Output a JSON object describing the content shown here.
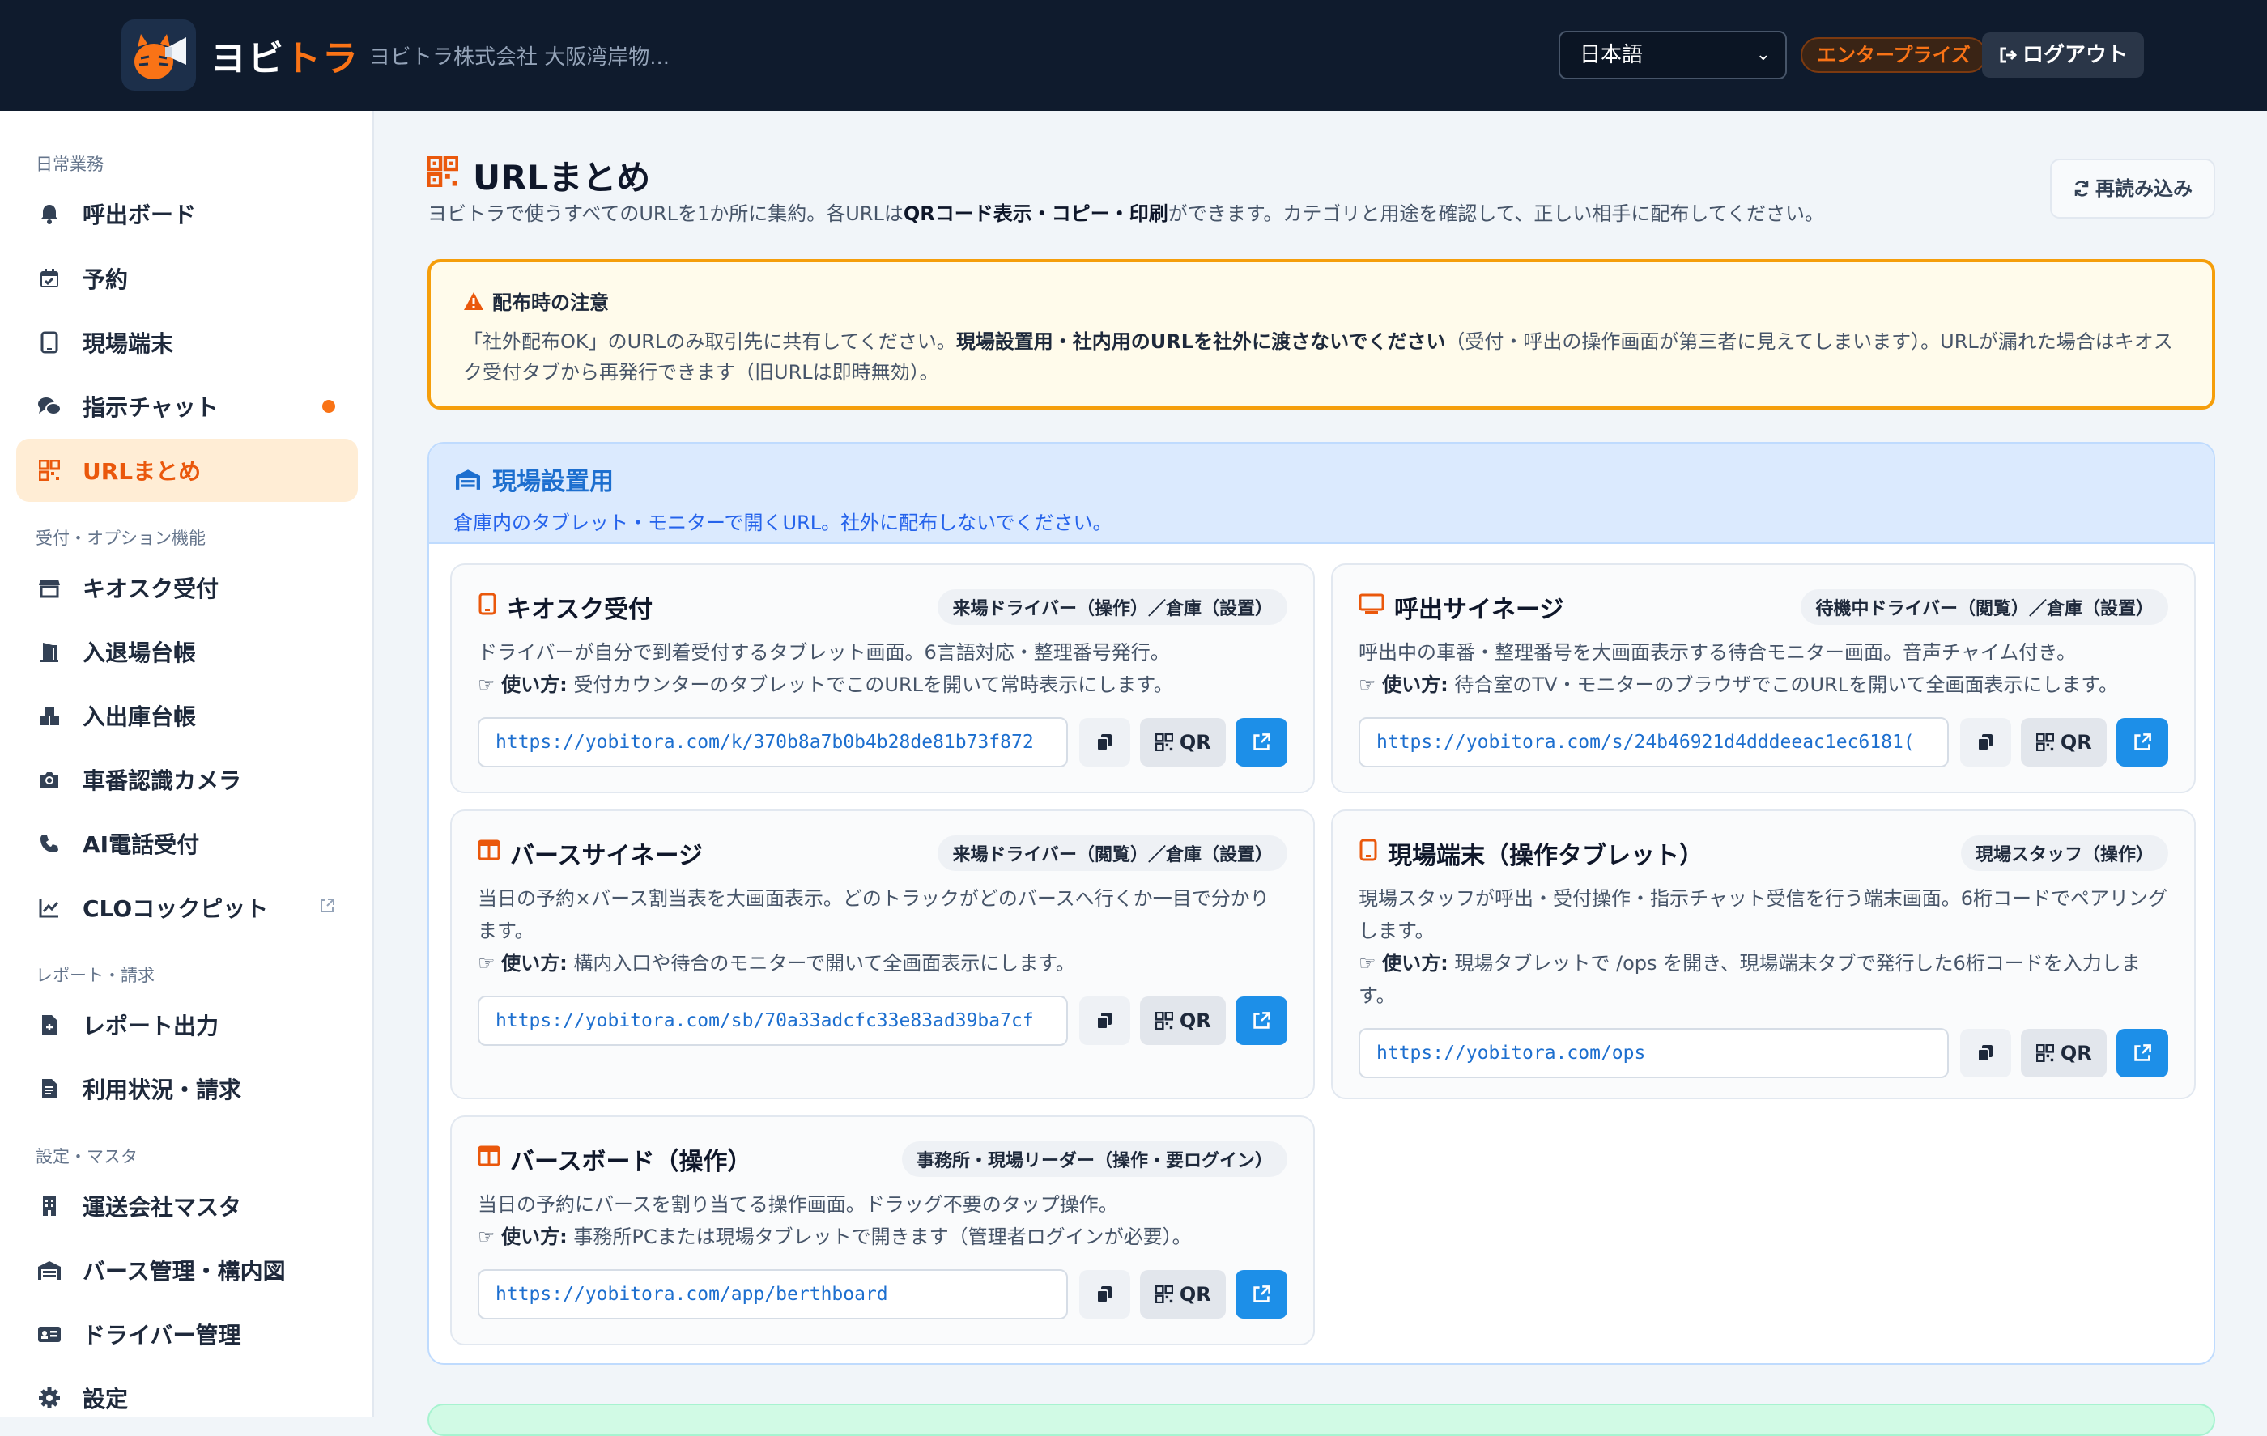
{
  "header": {
    "brand_part1": "ヨビ",
    "brand_part2": "トラ",
    "company": "ヨビトラ株式会社 大阪湾岸物...",
    "language": "日本語",
    "plan": "エンタープライズ",
    "logout": "ログアウト"
  },
  "sidebar": {
    "sections": [
      "日常業務",
      "受付・オプション機能",
      "レポート・請求",
      "設定・マスタ"
    ],
    "items": [
      {
        "label": "呼出ボード"
      },
      {
        "label": "予約"
      },
      {
        "label": "現場端末"
      },
      {
        "label": "指示チャット"
      },
      {
        "label": "URLまとめ"
      },
      {
        "label": "キオスク受付"
      },
      {
        "label": "入退場台帳"
      },
      {
        "label": "入出庫台帳"
      },
      {
        "label": "車番認識カメラ"
      },
      {
        "label": "AI電話受付"
      },
      {
        "label": "CLOコックピット"
      },
      {
        "label": "レポート出力"
      },
      {
        "label": "利用状況・請求"
      },
      {
        "label": "運送会社マスタ"
      },
      {
        "label": "バース管理・構内図"
      },
      {
        "label": "ドライバー管理"
      },
      {
        "label": "設定"
      }
    ]
  },
  "page": {
    "title": "URLまとめ",
    "sub_pre": "ヨビトラで使うすべてのURLを1か所に集約。各URLは",
    "sub_bold": "QRコード表示・コピー・印刷",
    "sub_post": "ができます。カテゴリと用途を確認して、正しい相手に配布してください。",
    "reload": "再読み込み"
  },
  "notice": {
    "title": "配布時の注意",
    "pre": "「社外配布OK」のURLのみ取引先に共有してください。",
    "bold": "現場設置用・社内用のURLを社外に渡さないでください",
    "post": "（受付・呼出の操作画面が第三者に見えてしまいます）。URLが漏れた場合はキオスク受付タブから再発行できます（旧URLは即時無効）。"
  },
  "section": {
    "title": "現場設置用",
    "sub": "倉庫内のタブレット・モニターで開くURL。社外に配布しないでください。",
    "usage_label": "使い方:",
    "qr_label": "QR",
    "cards": [
      {
        "title": "キオスク受付",
        "role": "来場ドライバー（操作）／倉庫（設置）",
        "desc": "ドライバーが自分で到着受付するタブレット画面。6言語対応・整理番号発行。",
        "usage": "受付カウンターのタブレットでこのURLを開いて常時表示にします。",
        "url": "https://yobitora.com/k/370b8a7b0b4b28de81b73f872"
      },
      {
        "title": "呼出サイネージ",
        "role": "待機中ドライバー（閲覧）／倉庫（設置）",
        "desc": "呼出中の車番・整理番号を大画面表示する待合モニター画面。音声チャイム付き。",
        "usage": "待合室のTV・モニターのブラウザでこのURLを開いて全画面表示にします。",
        "url": "https://yobitora.com/s/24b46921d4dddeeac1ec6181("
      },
      {
        "title": "バースサイネージ",
        "role": "来場ドライバー（閲覧）／倉庫（設置）",
        "desc": "当日の予約×バース割当表を大画面表示。どのトラックがどのバースへ行くか一目で分かります。",
        "usage": "構内入口や待合のモニターで開いて全画面表示にします。",
        "url": "https://yobitora.com/sb/70a33adcfc33e83ad39ba7cf"
      },
      {
        "title": "現場端末（操作タブレット）",
        "role": "現場スタッフ（操作）",
        "desc": "現場スタッフが呼出・受付操作・指示チャット受信を行う端末画面。6桁コードでペアリングします。",
        "usage": "現場タブレットで /ops を開き、現場端末タブで発行した6桁コードを入力します。",
        "url": "https://yobitora.com/ops"
      },
      {
        "title": "バースボード（操作）",
        "role": "事務所・現場リーダー（操作・要ログイン）",
        "desc": "当日の予約にバースを割り当てる操作画面。ドラッグ不要のタップ操作。",
        "usage": "事務所PCまたは現場タブレットで開きます（管理者ログインが必要）。",
        "url": "https://yobitora.com/app/berthboard"
      }
    ]
  },
  "colors": {
    "brand": "#f97316",
    "header_bg": "#0f1b2d",
    "primary": "#1d8fe8",
    "warning": "#f59e0b",
    "section_blue": "#dbeafe"
  }
}
